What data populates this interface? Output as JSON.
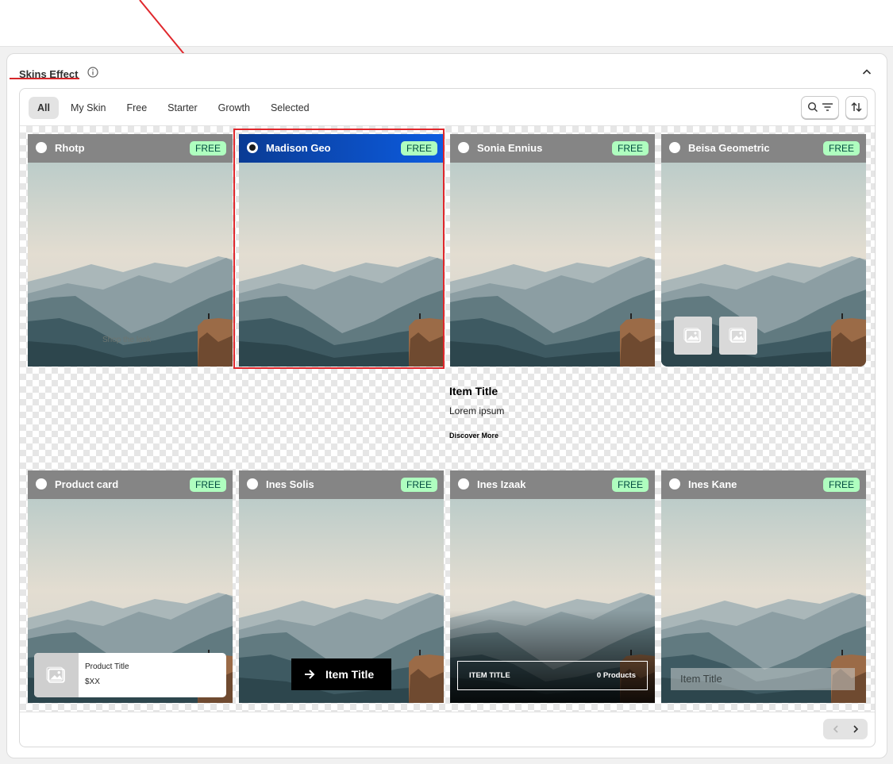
{
  "section": {
    "title": "Skins Effect"
  },
  "tabs": [
    {
      "label": "All",
      "active": true
    },
    {
      "label": "My Skin",
      "active": false
    },
    {
      "label": "Free",
      "active": false
    },
    {
      "label": "Starter",
      "active": false
    },
    {
      "label": "Growth",
      "active": false
    },
    {
      "label": "Selected",
      "active": false
    }
  ],
  "cards": [
    {
      "name": "Rhotp",
      "badge": "FREE",
      "selected": false,
      "overlay_text": "Shop the look"
    },
    {
      "name": "Madison Geo",
      "badge": "FREE",
      "selected": true
    },
    {
      "name": "Sonia Ennius",
      "badge": "FREE",
      "selected": false
    },
    {
      "name": "Beisa Geometric",
      "badge": "FREE",
      "selected": false
    },
    {
      "name": "Product card",
      "badge": "FREE",
      "selected": false,
      "product_title": "Product Title",
      "product_price": "$XX"
    },
    {
      "name": "Ines Solis",
      "badge": "FREE",
      "selected": false,
      "button_text": "Item Title"
    },
    {
      "name": "Ines Izaak",
      "badge": "FREE",
      "selected": false,
      "bar_left": "ITEM TITLE",
      "bar_right": "0 Products"
    },
    {
      "name": "Ines Kane",
      "badge": "FREE",
      "selected": false,
      "bar_text": "Item Title"
    }
  ],
  "item_block": {
    "title": "Item Title",
    "description": "Lorem ipsum",
    "link": "Discover More"
  },
  "colors": {
    "selected_header": "#0d4fc2",
    "badge_bg": "#affebf",
    "annotation": "#e0282d"
  }
}
